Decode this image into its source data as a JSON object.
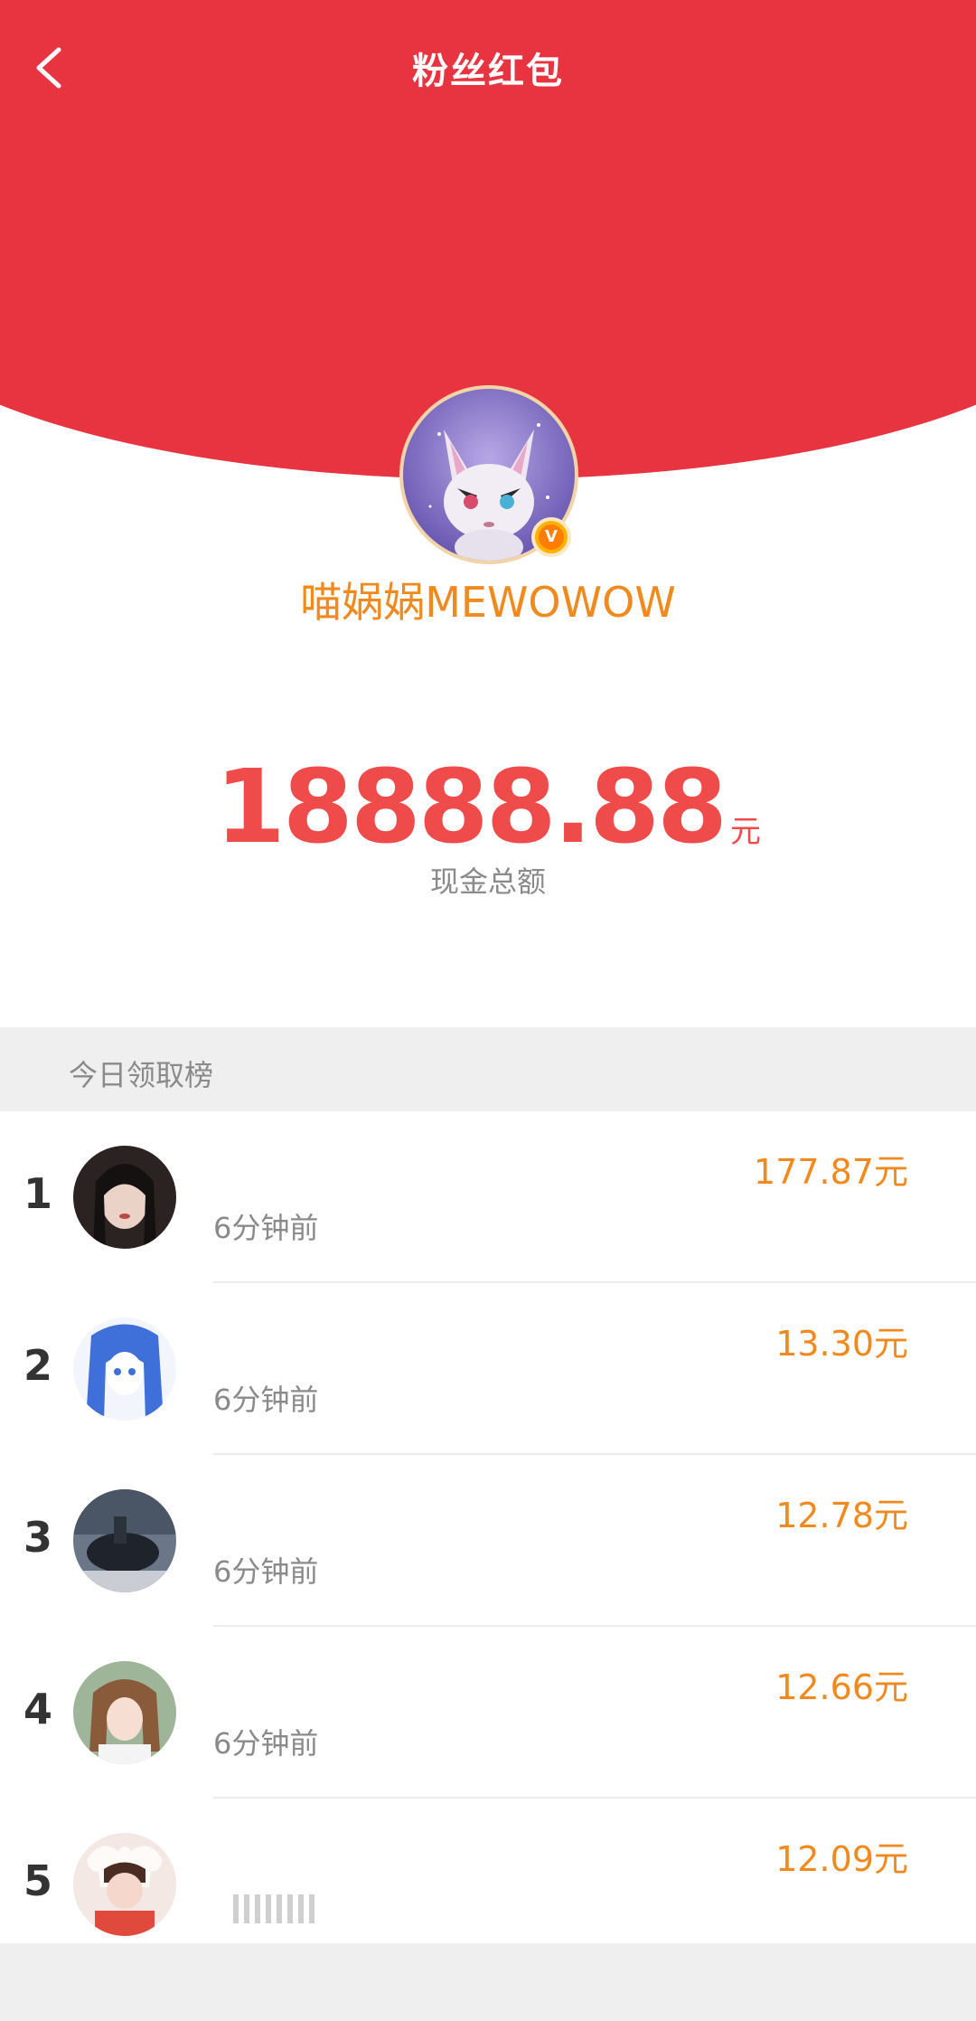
{
  "nav": {
    "title": "粉丝红包"
  },
  "profile": {
    "username": "喵娲娲MEWOWOW",
    "verified_badge": "V"
  },
  "summary": {
    "amount": "18888.88",
    "unit": "元",
    "label": "现金总额"
  },
  "ranking": {
    "title": "今日领取榜",
    "rows": [
      {
        "rank": "1",
        "amount": "177.87元",
        "time": "6分钟前"
      },
      {
        "rank": "2",
        "amount": "13.30元",
        "time": "6分钟前"
      },
      {
        "rank": "3",
        "amount": "12.78元",
        "time": "6分钟前"
      },
      {
        "rank": "4",
        "amount": "12.66元",
        "time": "6分钟前"
      },
      {
        "rank": "5",
        "amount": "12.09元",
        "time": ""
      }
    ]
  },
  "colors": {
    "header_red": "#e83440",
    "accent_orange": "#f08a1e",
    "amount_red": "#ef4b4b"
  },
  "icons": {
    "back": "chevron-left-icon",
    "verified": "verified-badge-icon"
  }
}
